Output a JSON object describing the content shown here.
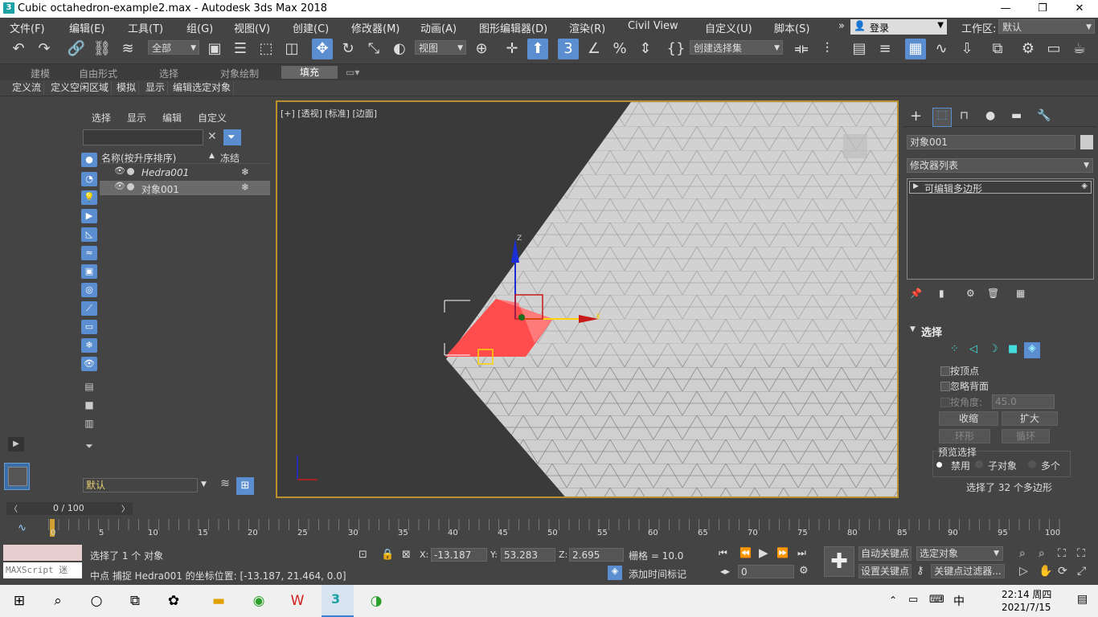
{
  "window": {
    "title": "Cubic octahedron-example2.max - Autodesk 3ds Max 2018",
    "app_icon": "3"
  },
  "menu": {
    "items": [
      "文件(F)",
      "编辑(E)",
      "工具(T)",
      "组(G)",
      "视图(V)",
      "创建(C)",
      "修改器(M)",
      "动画(A)",
      "图形编辑器(D)",
      "渲染(R)",
      "Civil View",
      "自定义(U)",
      "脚本(S)"
    ],
    "more": "»",
    "login": "登录",
    "workspace_label": "工作区:",
    "workspace_value": "默认"
  },
  "toolbar": {
    "selection_filter": "全部",
    "ref_coord": "视图",
    "named_selection": "创建选择集"
  },
  "ribbon": {
    "tabs": [
      "建模",
      "自由形式",
      "选择",
      "对象绘制",
      "填充"
    ],
    "active_tab": "填充",
    "buttons": [
      "定义流",
      "定义空闲区域",
      "模拟",
      "显示",
      "编辑选定对象"
    ]
  },
  "scene_explorer": {
    "menu": [
      "选择",
      "显示",
      "编辑",
      "自定义"
    ],
    "col_name": "名称(按升序排序)",
    "col_sort": "▲",
    "col_freeze": "冻结",
    "rows": [
      {
        "name": "Hedra001",
        "italic": true,
        "selected": false
      },
      {
        "name": "对象001",
        "italic": false,
        "selected": true
      }
    ],
    "layer": "默认"
  },
  "viewport": {
    "label": "[+] [透视] [标准] [边面]",
    "gizmo_axis_x": "X",
    "gizmo_axis_z": "Z"
  },
  "command_panel": {
    "object_name": "对象001",
    "modifier_list": "修改器列表",
    "stack_item": "可编辑多边形",
    "rollout_title": "选择",
    "by_vertex": "按顶点",
    "ignore_backface": "忽略背面",
    "by_angle": "按角度:",
    "angle_value": "45.0",
    "shrink": "收缩",
    "grow": "扩大",
    "ring": "环形",
    "loop": "循环",
    "preview_title": "预览选择",
    "preview_options": [
      "禁用",
      "子对象",
      "多个"
    ],
    "selected_info": "选择了 32 个多边形"
  },
  "timeline": {
    "frame_display": "0 / 100",
    "ticks": [
      "0",
      "5",
      "10",
      "15",
      "20",
      "25",
      "30",
      "35",
      "40",
      "45",
      "50",
      "55",
      "60",
      "65",
      "70",
      "75",
      "80",
      "85",
      "90",
      "95",
      "100"
    ]
  },
  "status": {
    "maxscript": "MAXScript 迷",
    "selected": "选择了 1 个 对象",
    "prompt": "中点 捕捉 Hedra001 的坐标位置:  [-13.187, 21.464, 0.0]",
    "x_label": "X:",
    "x_value": "-13.187",
    "y_label": "Y:",
    "y_value": "53.283",
    "z_label": "Z:",
    "z_value": "2.695",
    "grid": "栅格 = 10.0",
    "add_time_tag": "添加时间标记",
    "auto_key": "自动关键点",
    "set_key": "设置关键点",
    "key_filter_combo": "选定对象",
    "key_filters": "关键点过滤器...",
    "frame_value": "0"
  },
  "taskbar": {
    "ime": "中",
    "time": "22:14 周四",
    "date": "2021/7/15"
  },
  "colors": {
    "accent": "#5a8ed0",
    "viewport_border": "#b9922d",
    "selected_face": "#ff4d4d"
  }
}
